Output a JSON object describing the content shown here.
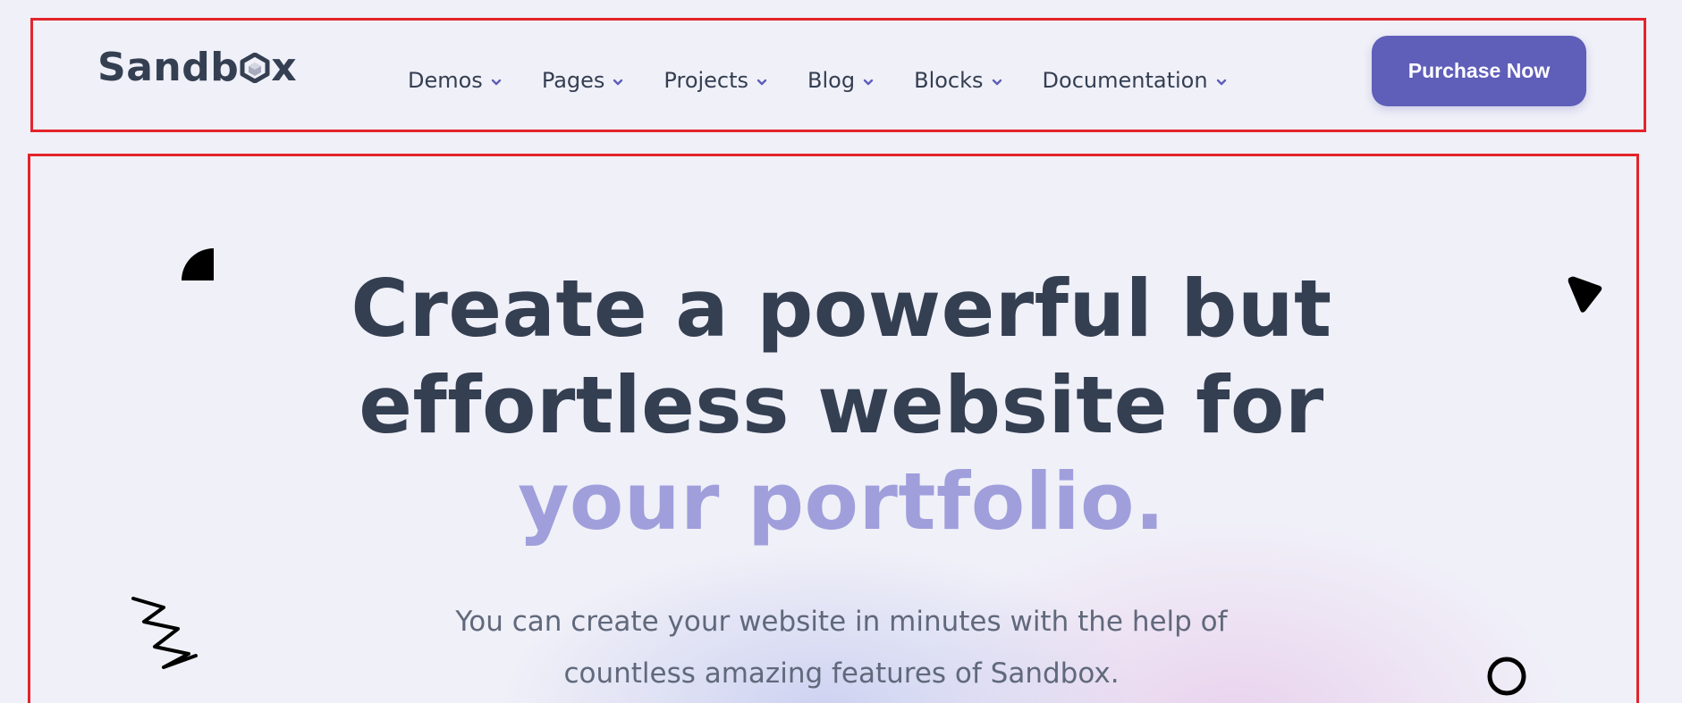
{
  "header": {
    "logo_text_before": "Sandb",
    "logo_text_after": "x",
    "nav_items": [
      {
        "label": "Demos",
        "icon": "chevron-down-icon"
      },
      {
        "label": "Pages",
        "icon": "chevron-down-icon"
      },
      {
        "label": "Projects",
        "icon": "chevron-down-icon"
      },
      {
        "label": "Blog",
        "icon": "chevron-down-icon"
      },
      {
        "label": "Blocks",
        "icon": "chevron-down-icon"
      },
      {
        "label": "Documentation",
        "icon": "chevron-down-icon"
      }
    ],
    "cta_label": "Purchase Now"
  },
  "hero": {
    "title_line1": "Create a powerful but",
    "title_line2": "effortless website for",
    "title_accent": "your portfolio.",
    "subtitle_line1": "You can create your website in minutes with the help of",
    "subtitle_line2": "countless amazing features of Sandbox."
  },
  "colors": {
    "primary": "#5f5eb9",
    "accent_text": "#a09fdc",
    "heading": "#343f52",
    "body_text": "#60697b",
    "background": "#f0f0f8",
    "annotation_outline": "#e3242b"
  },
  "icons": {
    "logo_mark": "hexagon-cube-icon",
    "decor": [
      "quarter-circle-icon",
      "triangle-icon",
      "zigzag-icon",
      "ring-icon"
    ]
  }
}
